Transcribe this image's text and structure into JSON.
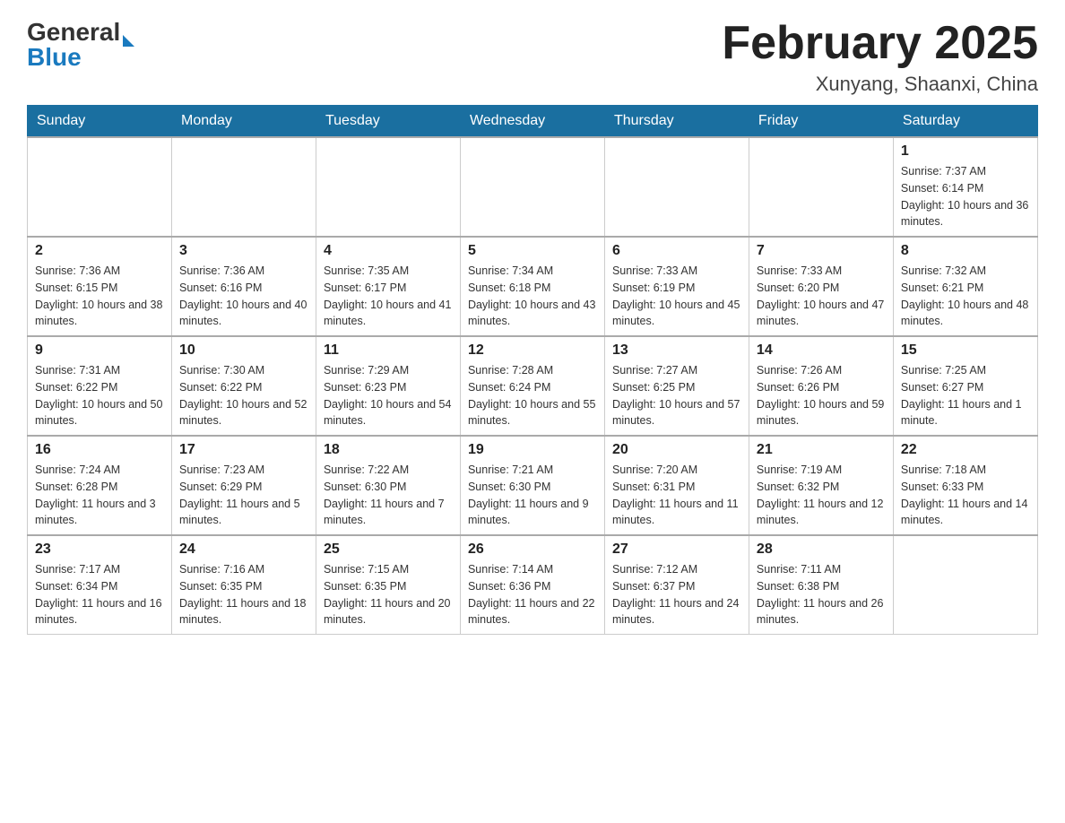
{
  "header": {
    "logo_general": "General",
    "logo_blue": "Blue",
    "title": "February 2025",
    "location": "Xunyang, Shaanxi, China"
  },
  "weekdays": [
    "Sunday",
    "Monday",
    "Tuesday",
    "Wednesday",
    "Thursday",
    "Friday",
    "Saturday"
  ],
  "weeks": [
    [
      {
        "day": "",
        "info": ""
      },
      {
        "day": "",
        "info": ""
      },
      {
        "day": "",
        "info": ""
      },
      {
        "day": "",
        "info": ""
      },
      {
        "day": "",
        "info": ""
      },
      {
        "day": "",
        "info": ""
      },
      {
        "day": "1",
        "info": "Sunrise: 7:37 AM\nSunset: 6:14 PM\nDaylight: 10 hours and 36 minutes."
      }
    ],
    [
      {
        "day": "2",
        "info": "Sunrise: 7:36 AM\nSunset: 6:15 PM\nDaylight: 10 hours and 38 minutes."
      },
      {
        "day": "3",
        "info": "Sunrise: 7:36 AM\nSunset: 6:16 PM\nDaylight: 10 hours and 40 minutes."
      },
      {
        "day": "4",
        "info": "Sunrise: 7:35 AM\nSunset: 6:17 PM\nDaylight: 10 hours and 41 minutes."
      },
      {
        "day": "5",
        "info": "Sunrise: 7:34 AM\nSunset: 6:18 PM\nDaylight: 10 hours and 43 minutes."
      },
      {
        "day": "6",
        "info": "Sunrise: 7:33 AM\nSunset: 6:19 PM\nDaylight: 10 hours and 45 minutes."
      },
      {
        "day": "7",
        "info": "Sunrise: 7:33 AM\nSunset: 6:20 PM\nDaylight: 10 hours and 47 minutes."
      },
      {
        "day": "8",
        "info": "Sunrise: 7:32 AM\nSunset: 6:21 PM\nDaylight: 10 hours and 48 minutes."
      }
    ],
    [
      {
        "day": "9",
        "info": "Sunrise: 7:31 AM\nSunset: 6:22 PM\nDaylight: 10 hours and 50 minutes."
      },
      {
        "day": "10",
        "info": "Sunrise: 7:30 AM\nSunset: 6:22 PM\nDaylight: 10 hours and 52 minutes."
      },
      {
        "day": "11",
        "info": "Sunrise: 7:29 AM\nSunset: 6:23 PM\nDaylight: 10 hours and 54 minutes."
      },
      {
        "day": "12",
        "info": "Sunrise: 7:28 AM\nSunset: 6:24 PM\nDaylight: 10 hours and 55 minutes."
      },
      {
        "day": "13",
        "info": "Sunrise: 7:27 AM\nSunset: 6:25 PM\nDaylight: 10 hours and 57 minutes."
      },
      {
        "day": "14",
        "info": "Sunrise: 7:26 AM\nSunset: 6:26 PM\nDaylight: 10 hours and 59 minutes."
      },
      {
        "day": "15",
        "info": "Sunrise: 7:25 AM\nSunset: 6:27 PM\nDaylight: 11 hours and 1 minute."
      }
    ],
    [
      {
        "day": "16",
        "info": "Sunrise: 7:24 AM\nSunset: 6:28 PM\nDaylight: 11 hours and 3 minutes."
      },
      {
        "day": "17",
        "info": "Sunrise: 7:23 AM\nSunset: 6:29 PM\nDaylight: 11 hours and 5 minutes."
      },
      {
        "day": "18",
        "info": "Sunrise: 7:22 AM\nSunset: 6:30 PM\nDaylight: 11 hours and 7 minutes."
      },
      {
        "day": "19",
        "info": "Sunrise: 7:21 AM\nSunset: 6:30 PM\nDaylight: 11 hours and 9 minutes."
      },
      {
        "day": "20",
        "info": "Sunrise: 7:20 AM\nSunset: 6:31 PM\nDaylight: 11 hours and 11 minutes."
      },
      {
        "day": "21",
        "info": "Sunrise: 7:19 AM\nSunset: 6:32 PM\nDaylight: 11 hours and 12 minutes."
      },
      {
        "day": "22",
        "info": "Sunrise: 7:18 AM\nSunset: 6:33 PM\nDaylight: 11 hours and 14 minutes."
      }
    ],
    [
      {
        "day": "23",
        "info": "Sunrise: 7:17 AM\nSunset: 6:34 PM\nDaylight: 11 hours and 16 minutes."
      },
      {
        "day": "24",
        "info": "Sunrise: 7:16 AM\nSunset: 6:35 PM\nDaylight: 11 hours and 18 minutes."
      },
      {
        "day": "25",
        "info": "Sunrise: 7:15 AM\nSunset: 6:35 PM\nDaylight: 11 hours and 20 minutes."
      },
      {
        "day": "26",
        "info": "Sunrise: 7:14 AM\nSunset: 6:36 PM\nDaylight: 11 hours and 22 minutes."
      },
      {
        "day": "27",
        "info": "Sunrise: 7:12 AM\nSunset: 6:37 PM\nDaylight: 11 hours and 24 minutes."
      },
      {
        "day": "28",
        "info": "Sunrise: 7:11 AM\nSunset: 6:38 PM\nDaylight: 11 hours and 26 minutes."
      },
      {
        "day": "",
        "info": ""
      }
    ]
  ]
}
